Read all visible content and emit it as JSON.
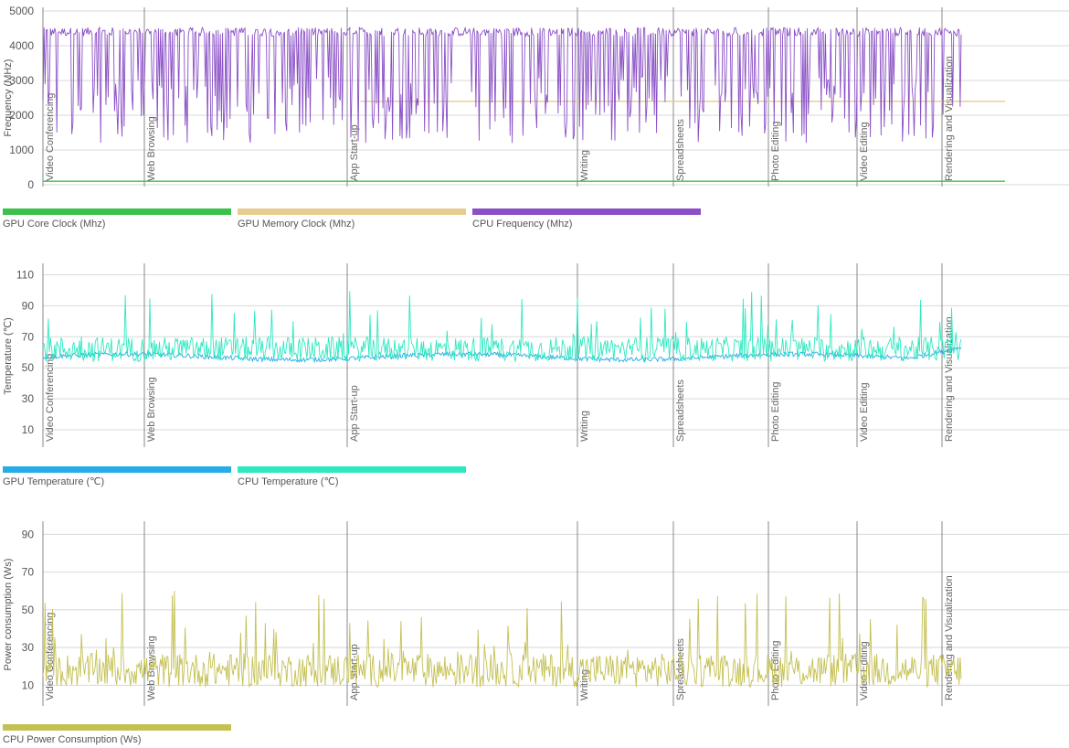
{
  "chart_data": [
    {
      "type": "line",
      "ylabel": "Frequency (MHz)",
      "ylim": [
        0,
        5000
      ],
      "yticks": [
        0,
        1000,
        2000,
        3000,
        4000,
        5000
      ],
      "grid": true,
      "legend_placement": "bottom",
      "segments": [
        "Video Conferencing",
        "Web Browsing",
        "App Start-up",
        "Writing",
        "Spreadsheets",
        "Photo Editing",
        "Video Editing",
        "Rendering and Visualization"
      ],
      "series": [
        {
          "name": "GPU Core Clock (Mhz)",
          "color": "#3cc24a",
          "style": "flat",
          "level": 100,
          "noise": 0
        },
        {
          "name": "GPU Memory Clock (Mhz)",
          "color": "#e6cc8e",
          "style": "flat_from",
          "level": 2400,
          "start": 0.33
        },
        {
          "name": "CPU Frequency (Mhz)",
          "color": "#8a4fc6",
          "style": "spiky",
          "high": 4400,
          "low": 1200,
          "noise": 250,
          "drop": 0.33,
          "end": 0.955
        }
      ]
    },
    {
      "type": "line",
      "ylabel": "Temperature (℃)",
      "ylim": [
        0,
        115
      ],
      "yticks": [
        10,
        30,
        50,
        70,
        90,
        110
      ],
      "grid": true,
      "legend_placement": "bottom",
      "segments": [
        "Video Conferencing",
        "Web Browsing",
        "App Start-up",
        "Writing",
        "Spreadsheets",
        "Photo Editing",
        "Video Editing",
        "Rendering and Visualization"
      ],
      "series": [
        {
          "name": "GPU Temperature (℃)",
          "color": "#26ace6",
          "style": "smooth",
          "base": 57,
          "noise": 3,
          "end": 0.955
        },
        {
          "name": "CPU Temperature (℃)",
          "color": "#2ee8c0",
          "style": "peaky",
          "base": 62,
          "noise": 8,
          "peak": 100,
          "end": 0.955
        }
      ]
    },
    {
      "type": "line",
      "ylabel": "Power consumption (Ws)",
      "ylim": [
        0,
        95
      ],
      "yticks": [
        10,
        30,
        50,
        70,
        90
      ],
      "grid": true,
      "legend_placement": "bottom",
      "segments": [
        "Video Conferencing",
        "Web Browsing",
        "App Start-up",
        "Writing",
        "Spreadsheets",
        "Photo Editing",
        "Video Editing",
        "Rendering and Visualization"
      ],
      "series": [
        {
          "name": "CPU Power Consumption (Ws)",
          "color": "#c4c052",
          "style": "peaky",
          "base": 18,
          "noise": 9,
          "peak": 60,
          "end": 0.955
        }
      ]
    }
  ]
}
